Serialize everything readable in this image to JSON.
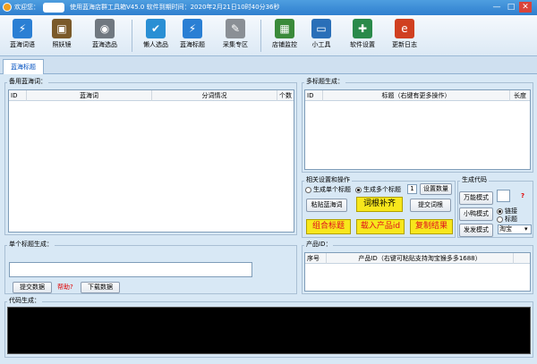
{
  "title": {
    "welcome": "欢迎您：",
    "text": "使用蓝海店群工具箱V45.0    软件到期时间：2020年2月21日10时40分36秒",
    "min": "—",
    "max": "□",
    "close": "✕"
  },
  "toolbar": [
    {
      "label": "蓝海词语",
      "icon": "shield-icon",
      "color": "#2a7fd4",
      "glyph": "⚡"
    },
    {
      "label": "照妖镜",
      "icon": "briefcase-icon",
      "color": "#7a5a2a",
      "glyph": "▣"
    },
    {
      "label": "蓝海选品",
      "icon": "disc-icon",
      "color": "#707880",
      "glyph": "◉"
    },
    {
      "label": "懒人选品",
      "icon": "check-shield-icon",
      "color": "#2a8fd4",
      "glyph": "✔"
    },
    {
      "label": "蓝海标题",
      "icon": "lightning-shield-icon",
      "color": "#2a7fd4",
      "glyph": "⚡"
    },
    {
      "label": "采集专区",
      "icon": "search-tool-icon",
      "color": "#8a8f95",
      "glyph": "✎"
    },
    {
      "label": "店铺监控",
      "icon": "monitor-icon",
      "color": "#3a8a3a",
      "glyph": "▦"
    },
    {
      "label": "小工具",
      "icon": "computer-icon",
      "color": "#2a6fb8",
      "glyph": "▭"
    },
    {
      "label": "软件设置",
      "icon": "settings-screen-icon",
      "color": "#2a8a4a",
      "glyph": "✚"
    },
    {
      "label": "更新日志",
      "icon": "ie-icon",
      "color": "#d04020",
      "glyph": "e"
    }
  ],
  "tab": "蓝海标题",
  "backup": {
    "legend": "备用蓝海词：",
    "cols": [
      "ID",
      "蓝海词",
      "分词情况",
      "个数"
    ]
  },
  "multi": {
    "legend": "多标题生成：",
    "cols": [
      "ID",
      "标题（右键有更多操作）",
      "长度"
    ]
  },
  "ops": {
    "legend": "相关设置和操作",
    "radio_single": "生成单个标题",
    "radio_multi": "生成多个标题",
    "count": "1",
    "set_count": "设置数量",
    "paste": "粘贴蓝海词",
    "fill": "词根补齐",
    "submit": "提交词根",
    "combine": "组合标题",
    "import": "载入产品id",
    "copy": "复制结果"
  },
  "code": {
    "legend": "生成代码",
    "universal": "万能模式",
    "small": "小鸭模式",
    "send": "发发模式",
    "q": "?",
    "link": "链接",
    "title": "标题",
    "platform": "淘宝"
  },
  "single": {
    "legend": "单个标题生成：",
    "submit": "提交数据",
    "help": "帮助?",
    "download": "下载数据"
  },
  "product": {
    "legend": "产品ID：",
    "cols": [
      "序号",
      "产品ID（右键可粘贴支持淘宝猴多多1688）"
    ]
  },
  "codegen": {
    "legend": "代码生成："
  }
}
